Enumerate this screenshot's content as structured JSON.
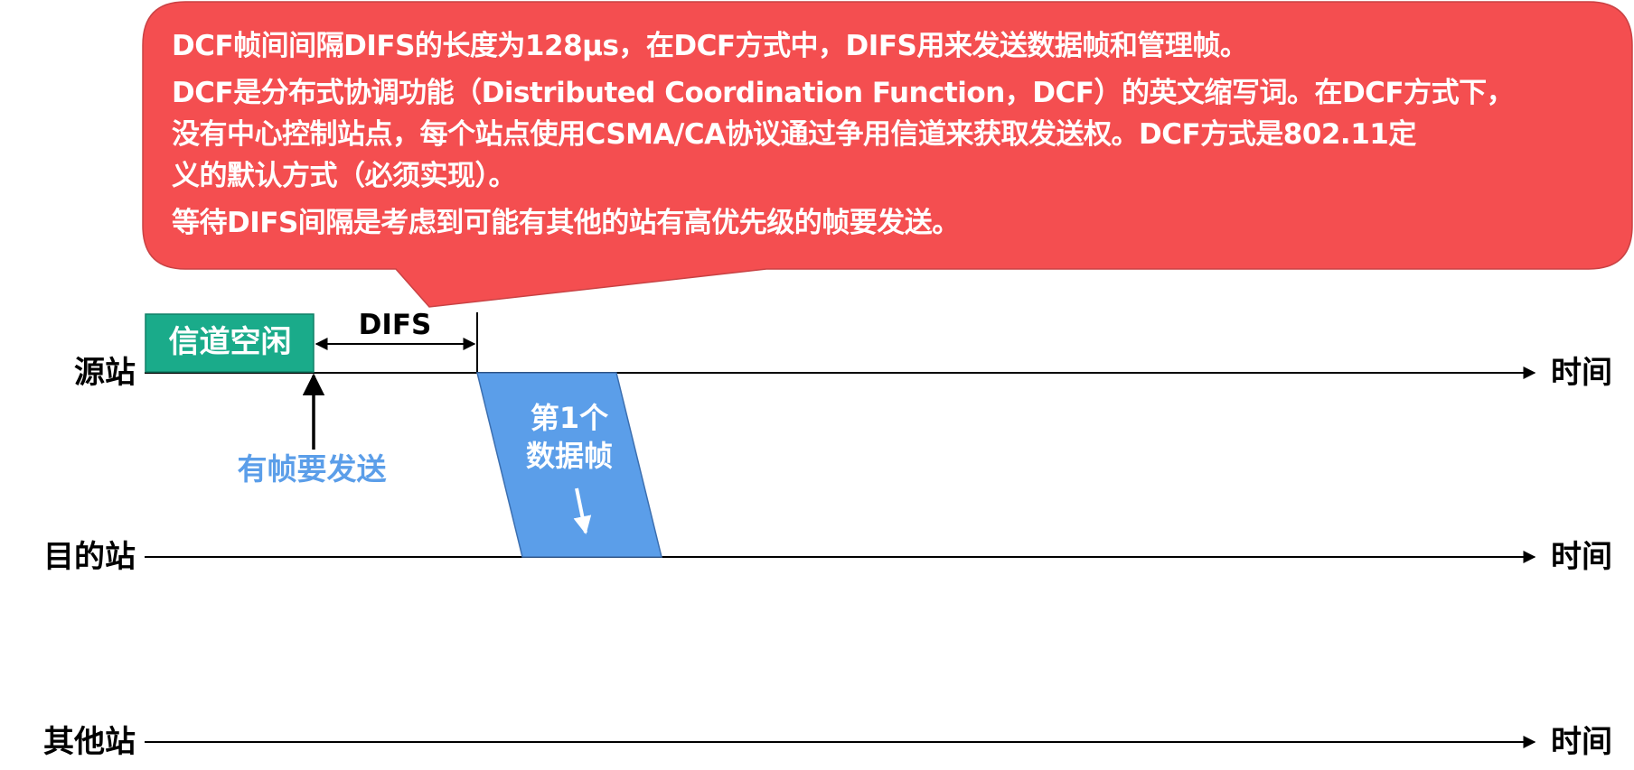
{
  "callout": {
    "line1": "DCF帧间间隔DIFS的长度为128μs，在DCF方式中，DIFS用来发送数据帧和管理帧。",
    "line2": "DCF是分布式协调功能（Distributed Coordination Function，DCF）的英文缩写词。在DCF方式下，",
    "line3": "没有中心控制站点，每个站点使用CSMA/CA协议通过争用信道来获取发送权。DCF方式是802.11定",
    "line4": "义的默认方式（必须实现）。",
    "line5": "等待DIFS间隔是考虑到可能有其他的站有高优先级的帧要发送。"
  },
  "stations": {
    "source": "源站",
    "destination": "目的站",
    "other": "其他站"
  },
  "time_label": "时间",
  "channel_idle": "信道空闲",
  "difs": "DIFS",
  "has_frame": "有帧要发送",
  "frame": {
    "line1": "第1个",
    "line2": "数据帧"
  },
  "colors": {
    "callout": "#f44e50",
    "idle_box": "#1aab8a",
    "frame": "#5b9ee9",
    "send_text": "#5b9ee9",
    "line": "#000000"
  }
}
